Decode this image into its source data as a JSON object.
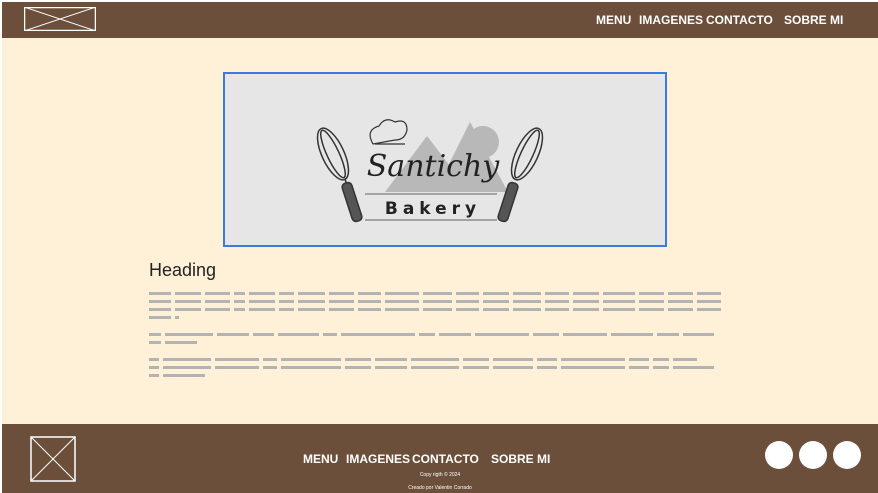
{
  "header": {
    "nav": [
      "MENU",
      "IMAGENES",
      "CONTACTO",
      "SOBRE MI"
    ]
  },
  "hero": {
    "brand_name": "Santichy",
    "brand_sub": "Bakery"
  },
  "content": {
    "heading": "Heading"
  },
  "footer": {
    "nav": [
      "MENU",
      "IMAGENES",
      "CONTACTO",
      "SOBRE MI"
    ],
    "copyright": "Copy rigth © 2024",
    "credit": "Creado por Valentin Corrado"
  },
  "colors": {
    "header_bg": "#6b4f3b",
    "page_bg": "#fff1d8",
    "accent_border": "#3b7be0"
  }
}
